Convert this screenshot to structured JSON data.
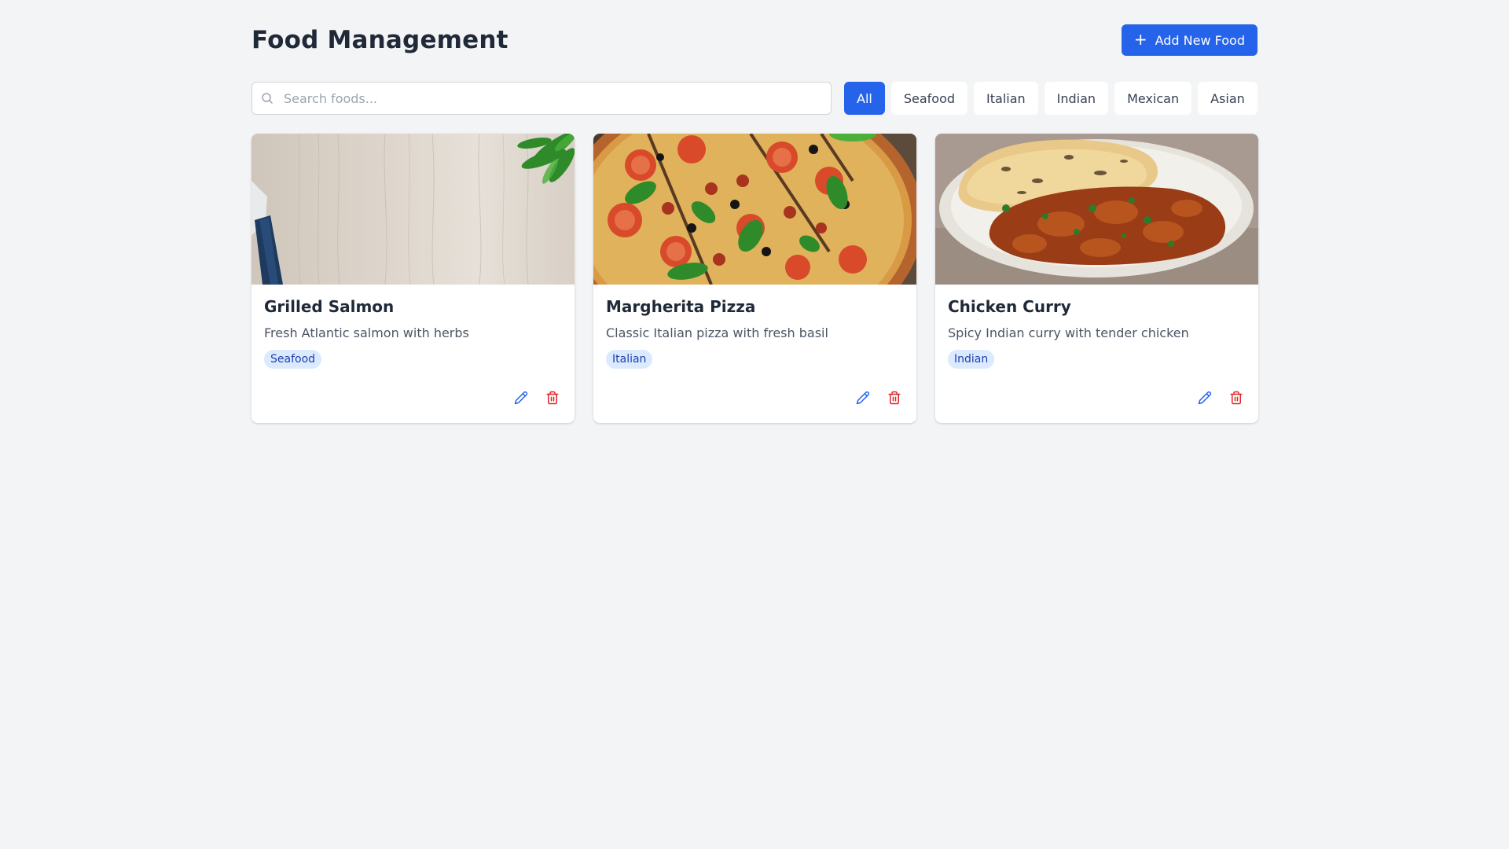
{
  "header": {
    "title": "Food Management",
    "add_button_label": "Add New Food",
    "add_button_icon": "plus-icon"
  },
  "search": {
    "placeholder": "Search foods...",
    "value": ""
  },
  "filters": [
    {
      "label": "All",
      "active": true
    },
    {
      "label": "Seafood",
      "active": false
    },
    {
      "label": "Italian",
      "active": false
    },
    {
      "label": "Indian",
      "active": false
    },
    {
      "label": "Mexican",
      "active": false
    },
    {
      "label": "Asian",
      "active": false
    }
  ],
  "foods": [
    {
      "name": "Grilled Salmon",
      "description": "Fresh Atlantic salmon with herbs",
      "category": "Seafood"
    },
    {
      "name": "Margherita Pizza",
      "description": "Classic Italian pizza with fresh basil",
      "category": "Italian"
    },
    {
      "name": "Chicken Curry",
      "description": "Spicy Indian curry with tender chicken",
      "category": "Indian"
    }
  ],
  "colors": {
    "accent": "#2563eb",
    "background": "#f3f4f6",
    "tag_bg": "#dbeafe",
    "tag_text": "#1e40af",
    "delete": "#dc2626"
  }
}
